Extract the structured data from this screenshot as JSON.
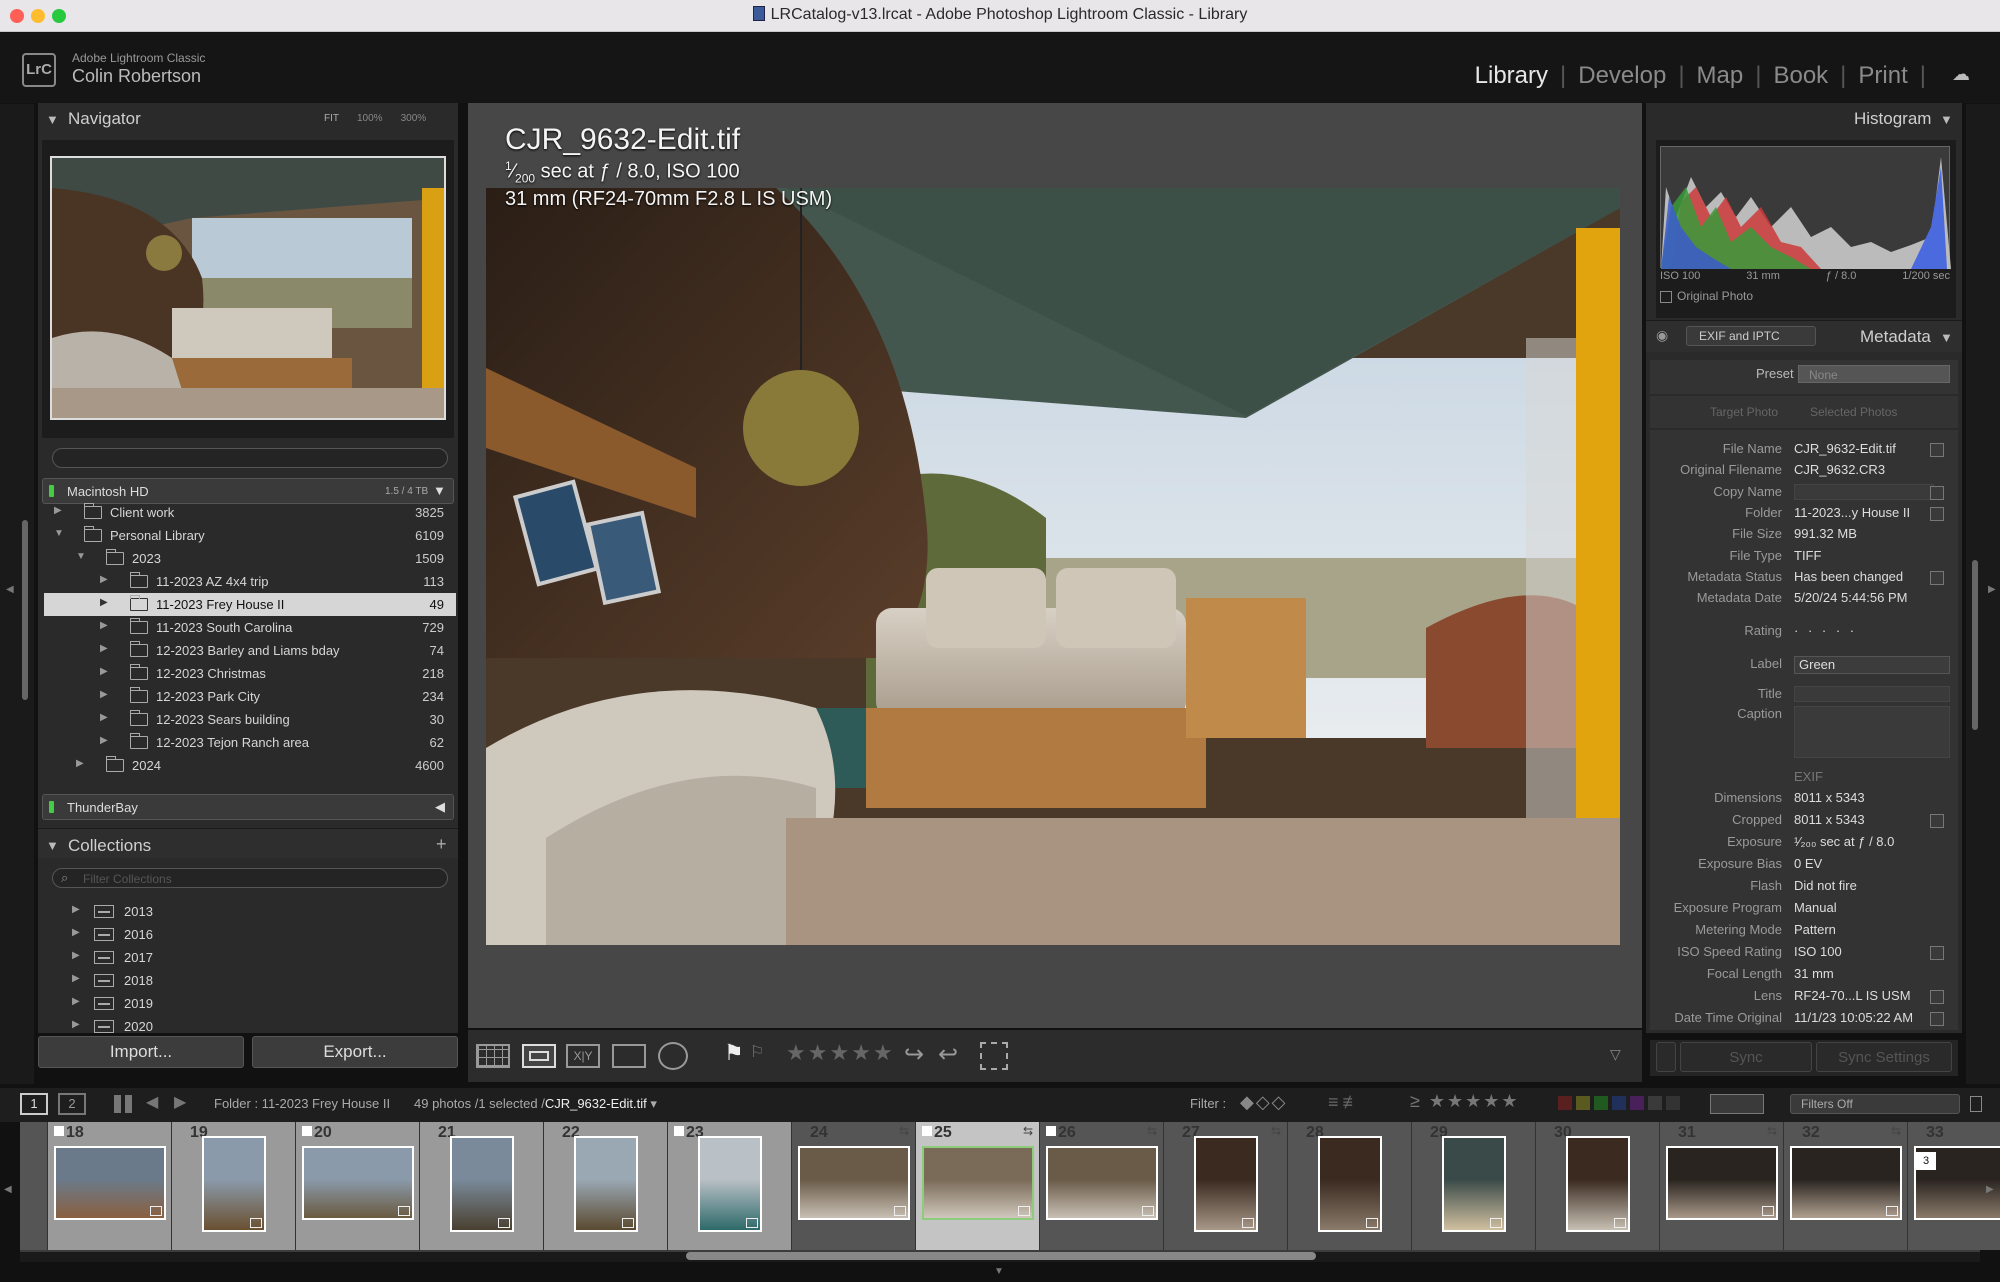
{
  "window": {
    "title": "LRCatalog-v13.lrcat - Adobe Photoshop Lightroom Classic - Library"
  },
  "identity": {
    "app": "Adobe Lightroom Classic",
    "user": "Colin Robertson",
    "logo": "LrC"
  },
  "modules": [
    "Library",
    "Develop",
    "Map",
    "Book",
    "Print"
  ],
  "navigator": {
    "title": "Navigator",
    "zoom": [
      "FIT",
      "100%",
      "300%"
    ]
  },
  "volumes": [
    {
      "name": "Macintosh HD",
      "size": "1.5 / 4 TB"
    },
    {
      "name": "ThunderBay"
    }
  ],
  "folders": [
    {
      "name": "Client work",
      "count": "3825",
      "level": 1
    },
    {
      "name": "Personal Library",
      "count": "6109",
      "level": 1
    },
    {
      "name": "2023",
      "count": "1509",
      "level": 2
    },
    {
      "name": "11-2023 AZ 4x4 trip",
      "count": "113",
      "level": 3
    },
    {
      "name": "11-2023 Frey House II",
      "count": "49",
      "level": 3
    },
    {
      "name": "11-2023 South Carolina",
      "count": "729",
      "level": 3
    },
    {
      "name": "12-2023 Barley and Liams bday",
      "count": "74",
      "level": 3
    },
    {
      "name": "12-2023 Christmas",
      "count": "218",
      "level": 3
    },
    {
      "name": "12-2023 Park City",
      "count": "234",
      "level": 3
    },
    {
      "name": "12-2023 Sears building",
      "count": "30",
      "level": 3
    },
    {
      "name": "12-2023 Tejon Ranch area",
      "count": "62",
      "level": 3
    },
    {
      "name": "2024",
      "count": "4600",
      "level": 2
    }
  ],
  "collections": {
    "title": "Collections",
    "filter_placeholder": "Filter Collections",
    "items": [
      "2013",
      "2016",
      "2017",
      "2018",
      "2019",
      "2020"
    ]
  },
  "buttons": {
    "import": "Import...",
    "export": "Export...",
    "sync": "Sync",
    "sync_settings": "Sync Settings"
  },
  "photo": {
    "filename": "CJR_9632-Edit.tif",
    "exposure_line": "sec at ƒ / 8.0, ISO 100",
    "shutter_num": "1",
    "shutter_den": "200",
    "lens_line": "31 mm (RF24-70mm F2.8 L IS USM)"
  },
  "histogram": {
    "title": "Histogram",
    "iso": "ISO 100",
    "focal": "31 mm",
    "aperture": "ƒ / 8.0",
    "shutter": "1/200 sec",
    "original_photo": "Original Photo"
  },
  "metadata": {
    "title": "Metadata",
    "set": "EXIF and IPTC",
    "preset_label": "Preset",
    "preset_value": "None",
    "target_photo": "Target Photo",
    "selected_photos": "Selected Photos",
    "rows": [
      {
        "k": "File Name",
        "v": "CJR_9632-Edit.tif"
      },
      {
        "k": "Original Filename",
        "v": "CJR_9632.CR3"
      },
      {
        "k": "Copy Name",
        "v": ""
      },
      {
        "k": "Folder",
        "v": "11-2023...y House II"
      },
      {
        "k": "File Size",
        "v": "991.32 MB"
      },
      {
        "k": "File Type",
        "v": "TIFF"
      },
      {
        "k": "Metadata Status",
        "v": "Has been changed"
      },
      {
        "k": "Metadata Date",
        "v": "5/20/24 5:44:56 PM"
      }
    ],
    "rating_label": "Rating",
    "rating_value": "· · · · ·",
    "label_label": "Label",
    "label_value": "Green",
    "title_label": "Title",
    "caption_label": "Caption",
    "exif_header": "EXIF",
    "exif": [
      {
        "k": "Dimensions",
        "v": "8011 x 5343"
      },
      {
        "k": "Cropped",
        "v": "8011 x 5343"
      },
      {
        "k": "Exposure",
        "v": "¹⁄₂₀₀ sec at ƒ / 8.0"
      },
      {
        "k": "Exposure Bias",
        "v": "0 EV"
      },
      {
        "k": "Flash",
        "v": "Did not fire"
      },
      {
        "k": "Exposure Program",
        "v": "Manual"
      },
      {
        "k": "Metering Mode",
        "v": "Pattern"
      },
      {
        "k": "ISO Speed Rating",
        "v": "ISO 100"
      },
      {
        "k": "Focal Length",
        "v": "31 mm"
      },
      {
        "k": "Lens",
        "v": "RF24-70...L IS USM"
      },
      {
        "k": "Date Time Original",
        "v": "11/1/23 10:05:22 AM"
      }
    ]
  },
  "filterbar": {
    "screen1": "1",
    "screen2": "2",
    "folder": "Folder : 11-2023 Frey House II",
    "count": "49 photos /1 selected /",
    "current": "CJR_9632-Edit.tif",
    "filter_label": "Filter :",
    "filters_off": "Filters Off"
  },
  "filmstrip": {
    "numbers": [
      "18",
      "19",
      "20",
      "21",
      "22",
      "23",
      "24",
      "25",
      "26",
      "27",
      "28",
      "29",
      "30",
      "31",
      "32",
      "33"
    ],
    "stack_count": "3"
  }
}
